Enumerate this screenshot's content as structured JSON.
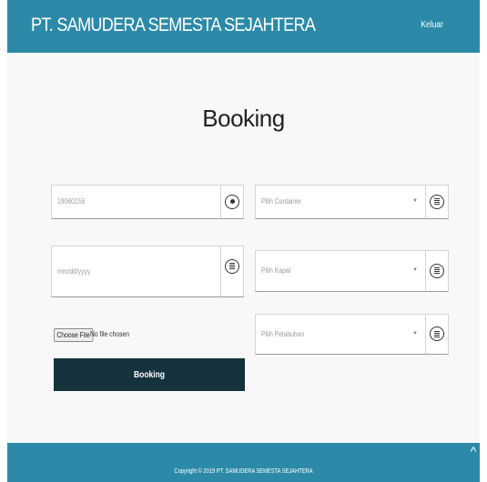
{
  "header": {
    "brand": "PT. SAMUDERA SEMESTA SEJAHTERA",
    "logout_label": "Keluar"
  },
  "page": {
    "title": "Booking"
  },
  "form": {
    "id_value": "19060156",
    "date_placeholder": "mm/dd/yyyy",
    "container_label": "Pilih Container",
    "ship_label": "Pilih Kapal",
    "port_label": "Pilih Pelabuhan",
    "file_button_label": "Choose File",
    "file_status": "No file chosen",
    "submit_label": "Booking"
  },
  "footer": {
    "copyright": "Copyright © 2019 PT. SAMUDERA SEMESTA SEJAHTERA",
    "scroll_top_label": "^"
  },
  "colors": {
    "header_bg": "#2c8aa8",
    "button_bg": "#16323c",
    "page_bg": "#f8f8f8"
  }
}
